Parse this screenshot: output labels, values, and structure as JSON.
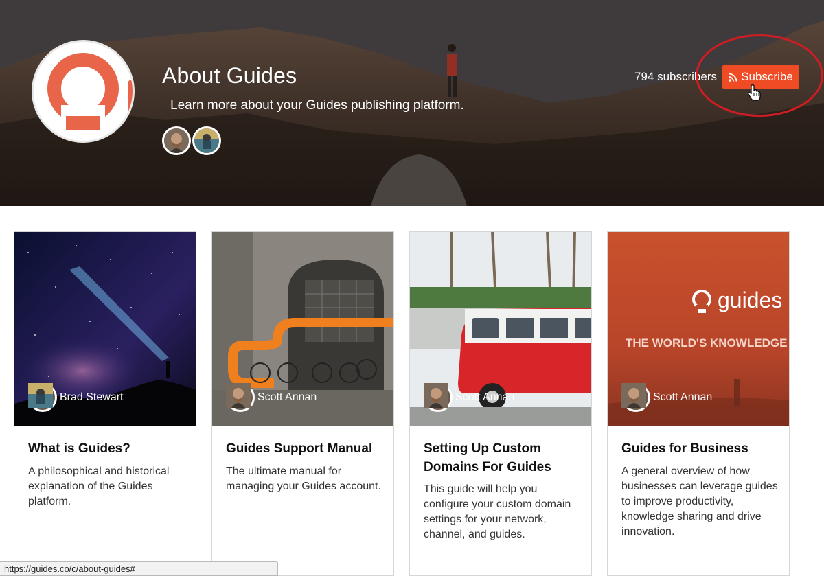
{
  "channel": {
    "title": "About Guides",
    "description": "Learn more about your Guides publishing platform.",
    "subscriber_count": "794 subscribers",
    "subscribe_label": "Subscribe",
    "accent_color": "#ef4c26"
  },
  "cards": [
    {
      "author": "Brad Stewart",
      "title": "What is Guides?",
      "description": "A philosophical and historical explanation of the Guides platform."
    },
    {
      "author": "Scott Annan",
      "title": "Guides Support Manual",
      "description": "The ultimate manual for managing your Guides account."
    },
    {
      "author": "Scott Annan",
      "title": "Setting Up Custom Domains For Guides",
      "description": "This guide will help you configure your custom domain settings for your network, channel, and guides."
    },
    {
      "author": "Scott Annan",
      "title": "Guides for Business",
      "description": "A general overview of how businesses can leverage guides to improve productivity, knowledge sharing and drive innovation."
    }
  ],
  "card4_image": {
    "brand": "guides",
    "tagline": "THE WORLD'S KNOWLEDGE I"
  },
  "status_bar": {
    "url": "https://guides.co/c/about-guides#"
  }
}
